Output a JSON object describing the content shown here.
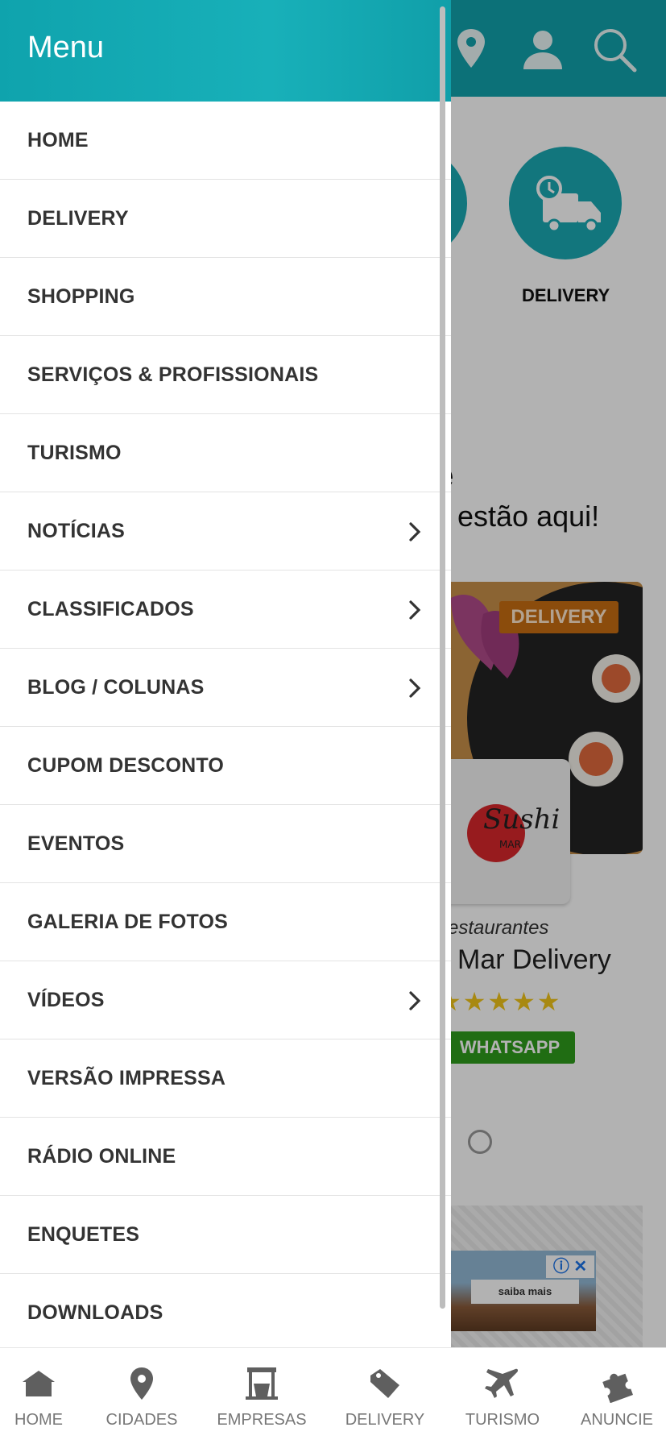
{
  "drawer": {
    "title": "Menu",
    "items": [
      {
        "label": "HOME",
        "has_submenu": false
      },
      {
        "label": "DELIVERY",
        "has_submenu": false
      },
      {
        "label": "SHOPPING",
        "has_submenu": false
      },
      {
        "label": "SERVIÇOS & PROFISSIONAIS",
        "has_submenu": false
      },
      {
        "label": "TURISMO",
        "has_submenu": false
      },
      {
        "label": "NOTÍCIAS",
        "has_submenu": true
      },
      {
        "label": "CLASSIFICADOS",
        "has_submenu": true
      },
      {
        "label": "BLOG / COLUNAS",
        "has_submenu": true
      },
      {
        "label": "CUPOM DESCONTO",
        "has_submenu": false
      },
      {
        "label": "EVENTOS",
        "has_submenu": false
      },
      {
        "label": "GALERIA DE FOTOS",
        "has_submenu": false
      },
      {
        "label": "VÍDEOS",
        "has_submenu": true
      },
      {
        "label": "VERSÃO IMPRESSA",
        "has_submenu": false
      },
      {
        "label": "RÁDIO ONLINE",
        "has_submenu": false
      },
      {
        "label": "ENQUETES",
        "has_submenu": false
      },
      {
        "label": "DOWNLOADS",
        "has_submenu": false
      }
    ]
  },
  "background": {
    "header_icons": [
      "location-pin-icon",
      "user-icon",
      "search-icon"
    ],
    "category_label": "DELIVERY",
    "headline_fragment": "e",
    "subheadline_fragment": "estão aqui!",
    "card": {
      "badge": "DELIVERY",
      "logo_text": "Sushi MAR",
      "category": "estaurantes",
      "name": "Mar Delivery",
      "stars": "★★★★★",
      "button": "WHATSAPP"
    },
    "ad": {
      "button": "saiba mais",
      "info": "ⓘ ✕"
    }
  },
  "bottom_nav": [
    {
      "label": "HOME",
      "icon": "home-icon"
    },
    {
      "label": "CIDADES",
      "icon": "location-pin-icon"
    },
    {
      "label": "EMPRESAS",
      "icon": "store-icon"
    },
    {
      "label": "DELIVERY",
      "icon": "tag-icon"
    },
    {
      "label": "TURISMO",
      "icon": "airplane-icon"
    },
    {
      "label": "ANUNCIE",
      "icon": "puzzle-icon"
    }
  ],
  "colors": {
    "teal": "#12a2ac",
    "delivery_badge": "#c86d12",
    "whatsapp": "#2f9c1c",
    "stars": "#f1c419",
    "menu_text": "#333333",
    "nav_text": "#777777"
  }
}
